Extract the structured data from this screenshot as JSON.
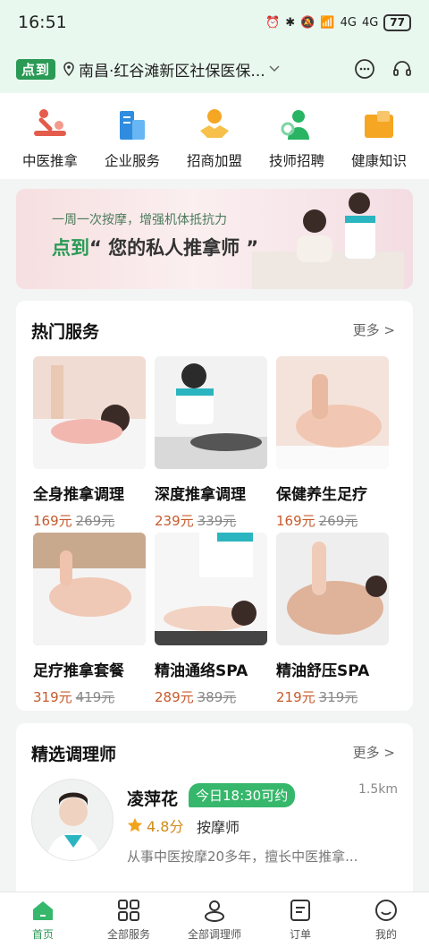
{
  "status": {
    "time": "16:51",
    "battery": "77",
    "signal1": "4G",
    "signal2": "4G"
  },
  "header": {
    "logo": "点到",
    "location": "南昌·红谷滩新区社保医保..."
  },
  "categories": [
    {
      "label": "中医推拿",
      "icon": "massage-icon"
    },
    {
      "label": "企业服务",
      "icon": "building-icon"
    },
    {
      "label": "招商加盟",
      "icon": "handshake-icon"
    },
    {
      "label": "技师招聘",
      "icon": "recruit-icon"
    },
    {
      "label": "健康知识",
      "icon": "folder-icon"
    }
  ],
  "banner": {
    "tagline": "一周一次按摩，增强机体抵抗力",
    "brand": "点到",
    "slogan": "“ 您的私人推拿师 ”"
  },
  "hot": {
    "title": "热门服务",
    "more": "更多 >",
    "items": [
      {
        "name": "全身推拿调理",
        "price": "169元",
        "old_price": "269元"
      },
      {
        "name": "深度推拿调理",
        "price": "239元",
        "old_price": "339元"
      },
      {
        "name": "保健养生足疗",
        "price": "169元",
        "old_price": "269元"
      },
      {
        "name": "足疗推拿套餐",
        "price": "319元",
        "old_price": "419元"
      },
      {
        "name": "精油通络SPA",
        "price": "289元",
        "old_price": "389元"
      },
      {
        "name": "精油舒压SPA",
        "price": "219元",
        "old_price": "319元"
      }
    ]
  },
  "selected": {
    "title": "精选调理师",
    "more": "更多 >",
    "tech": {
      "name": "凌萍花",
      "badge": "今日18:30可约",
      "distance": "1.5km",
      "rating": "4.8分",
      "role": "按摩师",
      "desc": "从事中医按摩20多年，擅长中医推拿..."
    }
  },
  "tabs": [
    {
      "label": "首页",
      "icon": "home-icon",
      "active": true
    },
    {
      "label": "全部服务",
      "icon": "grid-icon"
    },
    {
      "label": "全部调理师",
      "icon": "person-icon"
    },
    {
      "label": "订单",
      "icon": "order-icon"
    },
    {
      "label": "我的",
      "icon": "smile-icon"
    }
  ],
  "colors": {
    "brand": "#2a9a55",
    "price": "#c65b2c",
    "badge": "#36b76b"
  }
}
